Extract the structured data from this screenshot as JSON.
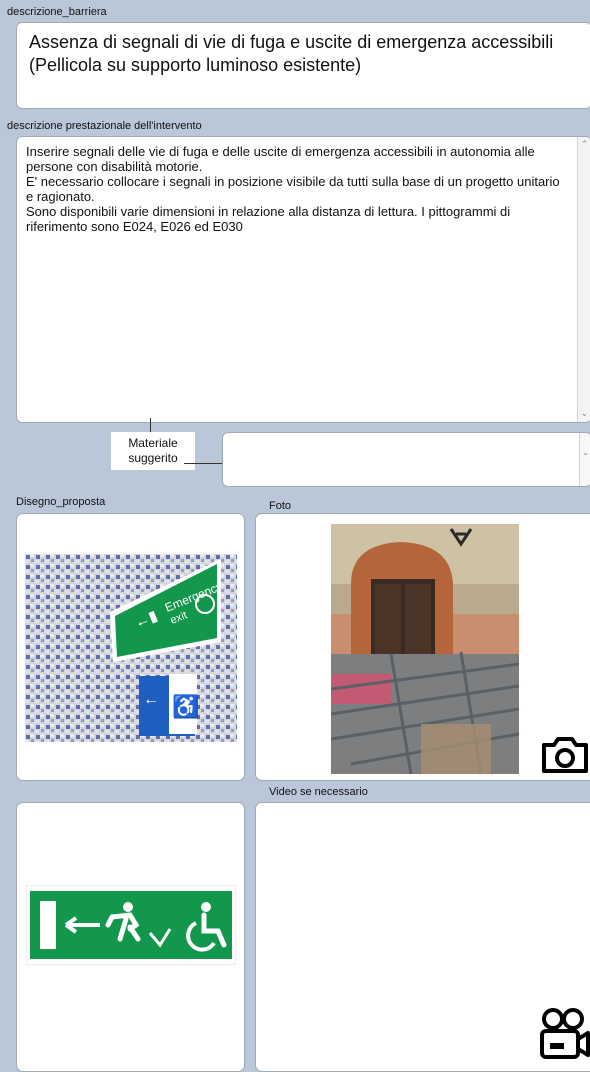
{
  "descrizione_barriera": {
    "label": "descrizione_barriera",
    "value": "Assenza di segnali di vie di fuga e uscite di emergenza accessibili (Pellicola su supporto luminoso esistente)"
  },
  "descrizione_prestazionale": {
    "label": "descrizione prestazionale dell'intervento",
    "value": "Inserire segnali delle vie di fuga e delle uscite di emergenza accessibili in autonomia alle persone con disabilità motorie.\nE' necessario collocare i segnali in posizione visibile da tutti sulla base di un progetto unitario e ragionato.\nSono disponibili varie dimensioni in relazione alla distanza di lettura. I pittogrammi di riferimento sono E024,  E026 ed E030"
  },
  "materiale": {
    "label": "Materiale suggerito",
    "value": ""
  },
  "disegno": {
    "label": "Disegno_proposta",
    "sign_texts": [
      "Emergency",
      "exit",
      "Emergency"
    ]
  },
  "foto": {
    "label": "Foto",
    "icon": "camera-icon"
  },
  "video": {
    "label": "Video se necessario",
    "icon": "video-camera-icon"
  },
  "colors": {
    "background": "#b9c7d8",
    "sign_green": "#12974c",
    "sign_blue": "#1f5fbf"
  }
}
